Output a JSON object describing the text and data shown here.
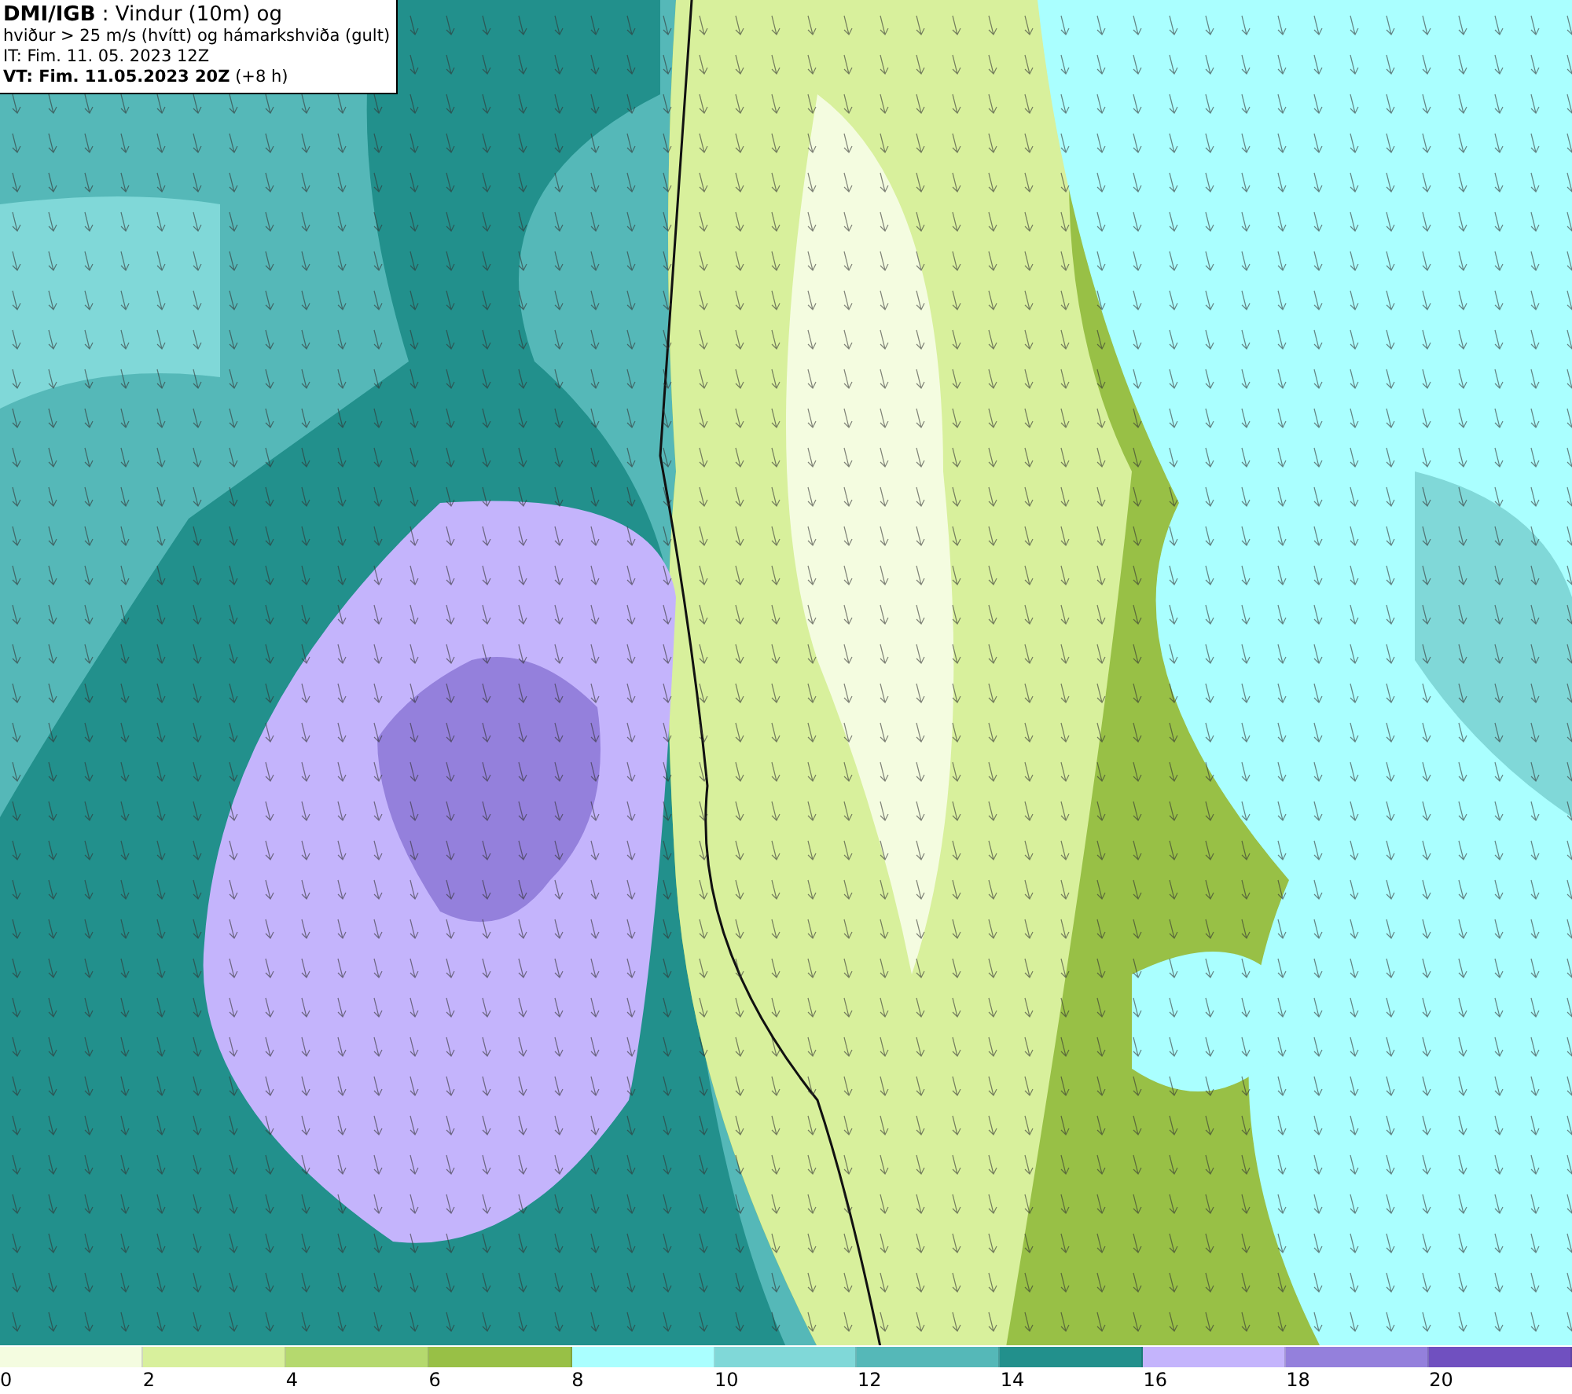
{
  "info_box": {
    "lines": [
      "**DMI/IGB** : Vindur (10m) og",
      "hviður > 25 m/s (hvítt) og hámarkshviða (gult)",
      "IT: Fim. 11. 05. 2023 12Z",
      "**VT: Fim. 11.05.2023 20Z** (+8 h)"
    ]
  },
  "legend": [
    {
      "color": "#f4fce0",
      "label": "0"
    },
    {
      "color": "#d8f09c",
      "label": "2"
    },
    {
      "color": "#b5d96e",
      "label": "4"
    },
    {
      "color": "#98c046",
      "label": "6"
    },
    {
      "color": "#aaffff",
      "label": "8"
    },
    {
      "color": "#80d8d8",
      "label": "10"
    },
    {
      "color": "#55b8b8",
      "label": "12"
    },
    {
      "color": "#22908c",
      "label": "14"
    },
    {
      "color": "#c4b4fc",
      "label": "16"
    },
    {
      "color": "#9480dc",
      "label": "18"
    },
    {
      "color": "#7050c0",
      "label": "20"
    }
  ]
}
